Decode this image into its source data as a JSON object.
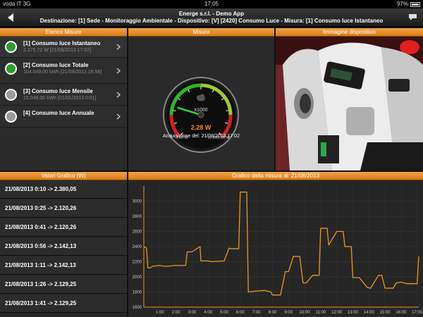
{
  "status": {
    "carrier": "voda IT",
    "network": "3G",
    "time": "17:05",
    "battery": "97%"
  },
  "nav": {
    "title_line1": "Energe s.r.l. - Demo App",
    "title_line2": "Destinazione: [1] Sede - Monitoraggio Ambientale - Dispositivo: [V] [2420] Consumo Luce - Misura: [1] Consumo luce Istantaneo"
  },
  "panels": {
    "elenco": "Elenco Misure",
    "misura": "Misura",
    "immagine": "Immagine dispositivo",
    "valori": "Valori Grafico (W)",
    "grafico": "Grafico della misura al: 21/08/2013"
  },
  "measures": [
    {
      "title": "[1] Consumo luce Istantaneo",
      "sub": "2.275,72 W [21/08/2013 17:02]",
      "color": "#2e9e2e"
    },
    {
      "title": "[2] Consumo luce Totale",
      "sub": "104.049,00 kWh [21/08/2013 16:56]",
      "color": "#2e9e2e"
    },
    {
      "title": "[3] Consumo luce Mensile",
      "sub": "15.049,00 kWh [01/01/2013 0:01]",
      "color": "#9a9a9a"
    },
    {
      "title": "[4] Consumo luce Annuale",
      "sub": "-",
      "color": "#9a9a9a"
    }
  ],
  "gauge": {
    "multiplier": "x1000",
    "value": "2,28 W",
    "min": "0,00 W",
    "max": "10.000,00 W",
    "acquisition": "Acquisizione del: 21/08/2013 17:02",
    "fraction": 0.23,
    "accent": "#ff8c1a"
  },
  "values": [
    "21/08/2013 0:10 -> 2.380,05",
    "21/08/2013 0:25 -> 2.120,26",
    "21/08/2013 0:41 -> 2.120,26",
    "21/08/2013 0:56 -> 2.142,13",
    "21/08/2013 1:11 -> 2.142,13",
    "21/08/2013 1:26 -> 2.129,25",
    "21/08/2013 1:41 -> 2.129,25"
  ],
  "chart_data": {
    "type": "line",
    "title": "Grafico della misura al: 21/08/2013",
    "xlabel": "",
    "ylabel": "",
    "xlim": [
      0,
      17.1
    ],
    "ylim": [
      1600,
      3200
    ],
    "yticks": [
      1600,
      1800,
      2000,
      2200,
      2400,
      2600,
      2800,
      3000
    ],
    "xticks": [
      "1:00",
      "2:00",
      "3:00",
      "4:00",
      "5:00",
      "6:00",
      "7:00",
      "8:00",
      "9:00",
      "10:00",
      "11:00",
      "12:00",
      "13:00",
      "14:00",
      "15:00",
      "16:00",
      "17:00"
    ],
    "grid": true,
    "line_color": "#f0961e",
    "series": [
      {
        "x": [
          0.0,
          0.17,
          0.25,
          0.42,
          0.55,
          1.0,
          1.2,
          1.5,
          2.0,
          2.6,
          2.7,
          3.0,
          3.5,
          3.55,
          4.0,
          4.2,
          5.0,
          5.3,
          5.45,
          5.9,
          6.0,
          6.4,
          6.5,
          6.9,
          7.5,
          7.9,
          8.0,
          8.5,
          8.8,
          9.0,
          9.3,
          9.7,
          9.9,
          10.1,
          10.5,
          10.9,
          11.0,
          11.4,
          11.5,
          12.0,
          12.4,
          12.5,
          12.9,
          13.0,
          13.4,
          13.9,
          14.1,
          14.6,
          14.8,
          15.0,
          15.5,
          15.7,
          16.0,
          16.4,
          16.6,
          17.0,
          17.1
        ],
        "y": [
          2400,
          2380,
          2120,
          2120,
          2140,
          2150,
          2140,
          2140,
          2150,
          2150,
          2330,
          2330,
          2400,
          2210,
          2210,
          2200,
          2210,
          2380,
          2370,
          2370,
          3120,
          3120,
          1800,
          1810,
          1820,
          1800,
          1760,
          1760,
          2070,
          2070,
          2270,
          2270,
          1920,
          1920,
          2020,
          2020,
          2640,
          2640,
          2420,
          2600,
          2600,
          2400,
          2400,
          1990,
          1990,
          1860,
          1850,
          2020,
          2020,
          1850,
          1850,
          1920,
          1930,
          1910,
          1910,
          1910,
          2270
        ]
      }
    ]
  }
}
